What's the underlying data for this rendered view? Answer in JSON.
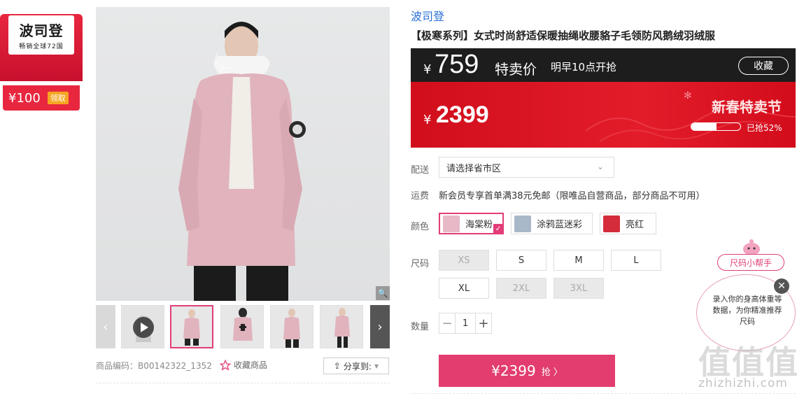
{
  "colors": {
    "accent": "#e23d78",
    "price_red": "#e31c2a",
    "dark_bar": "#1d1d1d",
    "buy_button": "#e23d6e",
    "link_blue": "#2a6fd6"
  },
  "brand_card": {
    "logo_text": "波司登",
    "logo_sub": "畅销全球72国",
    "coupon_amount": "¥100",
    "coupon_action": "领取"
  },
  "gallery": {
    "zoom_icon": "magnifier-icon",
    "product_code": "商品编码：B00142322_1352",
    "favorite_label": "收藏商品",
    "share_label": "分享到:"
  },
  "product": {
    "brand_link": "波司登",
    "title": "【极寒系列】女式时尚舒适保暖抽绳收腰貉子毛领防风鹅绒羽绒服"
  },
  "price": {
    "flash_yen": "¥",
    "flash_value": "759",
    "flash_label": "特卖价",
    "flash_start": "明早10点开抢",
    "collect_label": "收藏",
    "original_yen": "¥",
    "original_value": "2399",
    "festival_label": "新春特卖节",
    "progress_text": "已抢52%",
    "progress_pct": 52
  },
  "options": {
    "delivery_label": "配送",
    "delivery_placeholder": "请选择省市区",
    "shipping_label": "运费",
    "shipping_text": "新会员专享首单满38元免邮（限唯品自营商品，部分商品不可用）",
    "color_label": "颜色",
    "colors": [
      {
        "name": "海棠粉",
        "swatch": "#e7b8c6",
        "selected": true
      },
      {
        "name": "涂鸦蓝迷彩",
        "swatch": "#a9b8c8",
        "selected": false
      },
      {
        "name": "亮红",
        "swatch": "#d42c3a",
        "selected": false
      }
    ],
    "size_label": "尺码",
    "sizes": [
      {
        "label": "XS",
        "available": false
      },
      {
        "label": "S",
        "available": true
      },
      {
        "label": "M",
        "available": true
      },
      {
        "label": "L",
        "available": true
      },
      {
        "label": "XL",
        "available": true
      },
      {
        "label": "2XL",
        "available": false
      },
      {
        "label": "3XL",
        "available": false
      }
    ],
    "qty_label": "数量",
    "qty_value": "1"
  },
  "buy": {
    "price": "¥2399",
    "action": "抢 〉"
  },
  "size_helper": {
    "tag": "尺码小帮手",
    "text": "录入你的身高体重等数据，为你精准推荐尺码"
  },
  "watermark": {
    "big": "值值值",
    "small": "zhizhizhi.com"
  }
}
